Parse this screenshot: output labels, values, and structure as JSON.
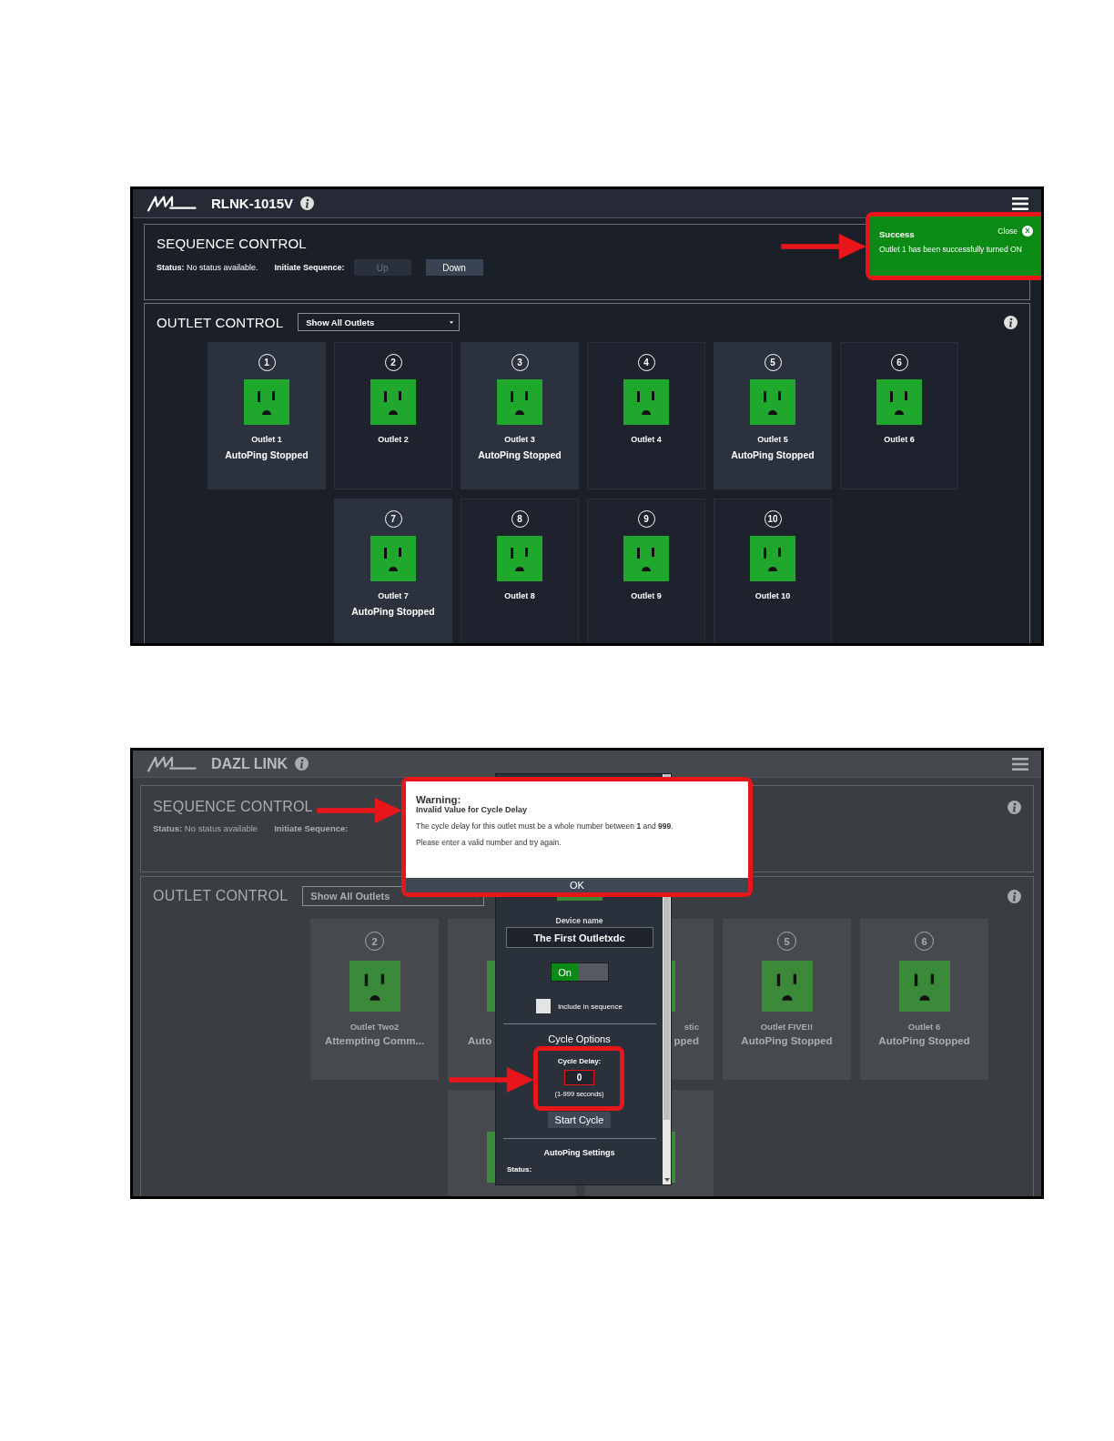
{
  "screenshots": [
    {
      "kind": "normal",
      "header": {
        "title": "RLNK-1015V"
      },
      "sequence": {
        "title": "SEQUENCE CONTROL",
        "status": "**Status:** No status available.",
        "initiate_label": "Initiate Sequence:",
        "buttons": [
          {
            "label": "Up",
            "disabled": true
          },
          {
            "label": "Down",
            "disabled": false
          }
        ]
      },
      "outlets": {
        "title": "OUTLET CONTROL",
        "filter": "Show All Outlets",
        "rows": [
          [
            {
              "kind": "full",
              "number": "1",
              "name": "Outlet 1",
              "status": "AutoPing Stopped",
              "highlighted": true,
              "on": true
            },
            {
              "kind": "full",
              "number": "2",
              "name": "Outlet 2",
              "highlighted": false,
              "on": true
            },
            {
              "kind": "full",
              "number": "3",
              "name": "Outlet 3",
              "status": "AutoPing Stopped",
              "highlighted": true,
              "on": true
            },
            {
              "kind": "full",
              "number": "4",
              "name": "Outlet 4",
              "highlighted": false,
              "on": true
            },
            {
              "kind": "full",
              "number": "5",
              "name": "Outlet 5",
              "status": "AutoPing Stopped",
              "highlighted": true,
              "on": true
            },
            {
              "kind": "full",
              "number": "6",
              "name": "Outlet 6",
              "highlighted": false,
              "on": true
            }
          ],
          [
            "",
            {
              "kind": "full",
              "number": "7",
              "name": "Outlet 7",
              "status": "AutoPing Stopped",
              "highlighted": true,
              "on": true
            },
            {
              "kind": "full",
              "number": "8",
              "name": "Outlet 8",
              "highlighted": false,
              "on": true
            },
            {
              "kind": "full",
              "number": "9",
              "name": "Outlet 9",
              "highlighted": false,
              "on": true
            },
            {
              "kind": "full",
              "number": "10",
              "name": "Outlet 10",
              "highlighted": false,
              "on": true
            }
          ]
        ]
      },
      "toast": {
        "title": "Success",
        "close": "Close",
        "close_icon": "X",
        "message": "Outlet 1 has been successfully turned ON"
      }
    },
    {
      "kind": "dimmed",
      "header": {
        "title": "DAZL LINK"
      },
      "sequence": {
        "title": "SEQUENCE CONTROL",
        "status": "**Status:** No status available",
        "initiate_label": "Initiate Sequence:",
        "info": true
      },
      "outlets": {
        "title": "OUTLET CONTROL",
        "filter": "Show All Outlets",
        "rows": [
          [
            {
              "kind": "full",
              "number": "2",
              "name": "Outlet Two2",
              "status": "Attempting Comm...",
              "on": true
            },
            {
              "kind": "strip-left",
              "status": "Auto",
              "on": true
            },
            {
              "kind": "strip-right",
              "name": "stic",
              "status": "pped",
              "on": true
            },
            {
              "kind": "full",
              "number": "5",
              "name": "Outlet FIVE!!",
              "status": "AutoPing Stopped",
              "on": true
            },
            {
              "kind": "full",
              "number": "6",
              "name": "Outlet 6",
              "status": "AutoPing Stopped",
              "on": true
            }
          ],
          [
            "",
            {
              "kind": "hidden",
              "on": true
            },
            {
              "kind": "hidden",
              "on": true
            }
          ]
        ]
      },
      "settings": {
        "device_label": "Device name",
        "device_name": "The First Outletxdc",
        "toggle": {
          "label": "On",
          "on": true
        },
        "sequence_checkbox": {
          "label": "include in sequence",
          "checked": false
        },
        "cycle_title": "Cycle Options",
        "cycle_delay": {
          "label": "Cycle Delay:",
          "value": "0",
          "hint": "(1-999 seconds)",
          "invalid": true
        },
        "cycle_button": "Start Cycle",
        "autoping_title": "AutoPing Settings",
        "autoping_status_label": "Status:"
      },
      "dialog": {
        "title": "Warning:",
        "subtitle": "Invalid Value for Cycle Delay",
        "messages": [
          "The cycle delay for this outlet must be a whole number between **1** and **999**.",
          "Please enter a valid number and try again."
        ],
        "button": "OK"
      }
    }
  ]
}
